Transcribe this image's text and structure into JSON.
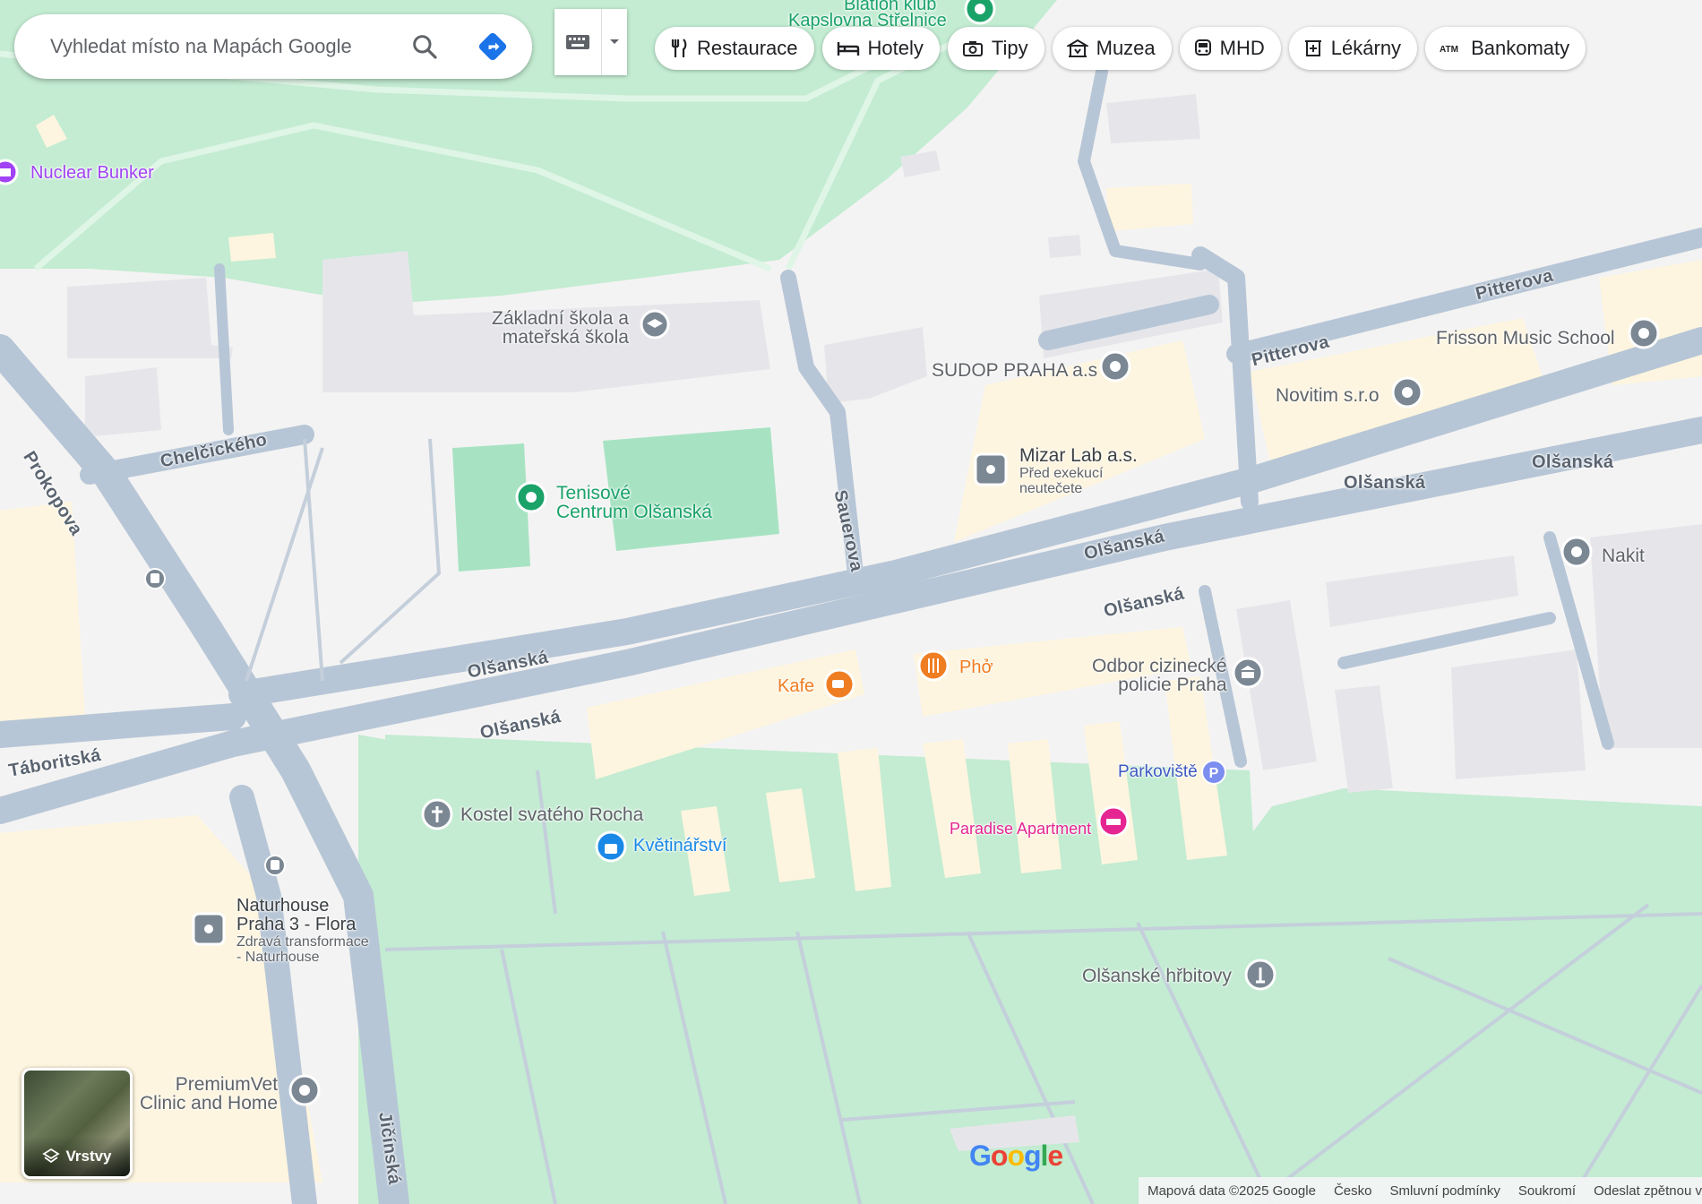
{
  "search": {
    "placeholder": "Vyhledat místo na Mapách Google"
  },
  "chips": [
    {
      "label": "Restaurace",
      "icon": "fork-knife-icon"
    },
    {
      "label": "Hotely",
      "icon": "bed-icon"
    },
    {
      "label": "Tipy",
      "icon": "camera-icon"
    },
    {
      "label": "Muzea",
      "icon": "museum-icon"
    },
    {
      "label": "MHD",
      "icon": "transit-icon"
    },
    {
      "label": "Lékárny",
      "icon": "pharmacy-icon"
    },
    {
      "label": "Bankomaty",
      "icon": "atm-icon"
    }
  ],
  "places": {
    "biatlon": "Biatlon klub",
    "kapslovna": "Kapslovna Střelnice",
    "nuclear_bunker": "Nuclear Bunker",
    "zakladni_skola_1": "Základní škola a",
    "zakladni_skola_2": "mateřská škola",
    "tenis_1": "Tenisové",
    "tenis_2": "Centrum Olšanská",
    "sudop": "SUDOP PRAHA a.s",
    "mizar": "Mizar Lab a.s.",
    "mizar_sub_1": "Před exekucí",
    "mizar_sub_2": "neutečete",
    "frisson": "Frisson Music School",
    "novitim": "Novitim s.r.o",
    "nakit": "Nakit",
    "kafe": "Kafe",
    "pho": "Phở",
    "odbor_1": "Odbor cizinecké",
    "odbor_2": "policie Praha",
    "parkoviste": "Parkoviště",
    "paradise": "Paradise Apartment",
    "kostel": "Kostel svatého Rocha",
    "kvetinarstvi": "Květinářství",
    "naturhouse_1": "Naturhouse",
    "naturhouse_2": "Praha 3 - Flora",
    "naturhouse_sub_1": "Zdravá transformace",
    "naturhouse_sub_2": "- Naturhouse",
    "hrbitovy": "Olšanské hřbitovy",
    "premiumvet_1": "PremiumVet",
    "premiumvet_2": "Clinic and Home"
  },
  "streets": {
    "prokopova": "Prokopova",
    "chelcickeho": "Chelčického",
    "sauerova": "Sauerova",
    "pitterova": "Pitterova",
    "olsanska": "Olšanská",
    "taboritska": "Táboritská",
    "jicinska": "Jičínská"
  },
  "layers_label": "Vrstvy",
  "logo": "Google",
  "footer": {
    "data": "Mapová data ©2025 Google",
    "country": "Česko",
    "terms": "Smluvní podmínky",
    "privacy": "Soukromí",
    "feedback": "Odeslat zpětnou v"
  },
  "colors": {
    "park": "#c3ecd2",
    "road": "#b7c6d6",
    "building": "#e8e8ec",
    "building_yellow": "#fdf5df",
    "poi_grey": "#7b8793",
    "poi_green": "#1aa269",
    "poi_orange": "#ef7d22",
    "poi_purple": "#a142f4",
    "poi_pink": "#e52592",
    "poi_blue": "#1a88e6",
    "accent": "#4285f4"
  }
}
